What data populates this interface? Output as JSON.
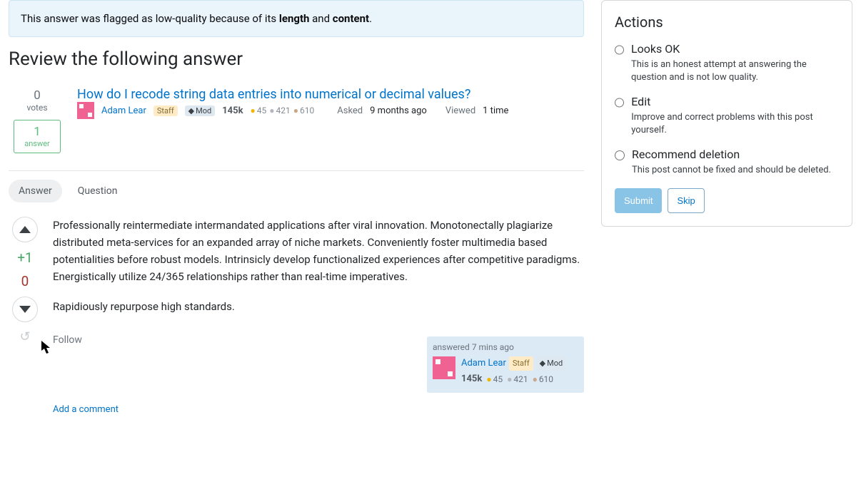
{
  "flag": {
    "prefix": "This answer was flagged as low-quality because of its ",
    "bold1": "length",
    "mid": " and ",
    "bold2": "content",
    "suffix": "."
  },
  "heading": "Review the following answer",
  "question": {
    "votes": "0",
    "votes_label": "votes",
    "answers_count": "1",
    "answers_label": "answer",
    "title": "How do I recode string data entries into numerical or decimal values?",
    "author": "Adam Lear",
    "staff_badge": "Staff",
    "mod_badge": "Mod",
    "rep": "145k",
    "gold": "45",
    "silver": "421",
    "bronze": "610",
    "asked_label": "Asked",
    "asked_val": "9 months ago",
    "viewed_label": "Viewed",
    "viewed_val": "1 time"
  },
  "tabs": {
    "answer": "Answer",
    "question": "Question"
  },
  "answer": {
    "vote_delta": "+1",
    "vote_score": "0",
    "follow": "Follow",
    "para1": "Professionally reintermediate intermandated applications after viral innovation. Monotonectally plagiarize distributed meta-services for an expanded array of niche markets. Conveniently foster multimedia based potentialities before robust models. Intrinsicly develop functionalized experiences after competitive paradigms. Energistically utilize 24/365 relationships rather than real-time imperatives.",
    "para2": "Rapidiously repurpose high standards.",
    "answered_label": "answered",
    "answered_val": "7 mins ago",
    "author": "Adam Lear",
    "staff_badge": "Staff",
    "mod_badge": "Mod",
    "rep": "145k",
    "gold": "45",
    "silver": "421",
    "bronze": "610",
    "add_comment": "Add a comment"
  },
  "sidebar": {
    "title": "Actions",
    "actions": [
      {
        "title": "Looks OK",
        "desc": "This is an honest attempt at answering the question and is not low quality."
      },
      {
        "title": "Edit",
        "desc": "Improve and correct problems with this post yourself."
      },
      {
        "title": "Recommend deletion",
        "desc": "This post cannot be fixed and should be deleted."
      }
    ],
    "submit": "Submit",
    "skip": "Skip"
  }
}
